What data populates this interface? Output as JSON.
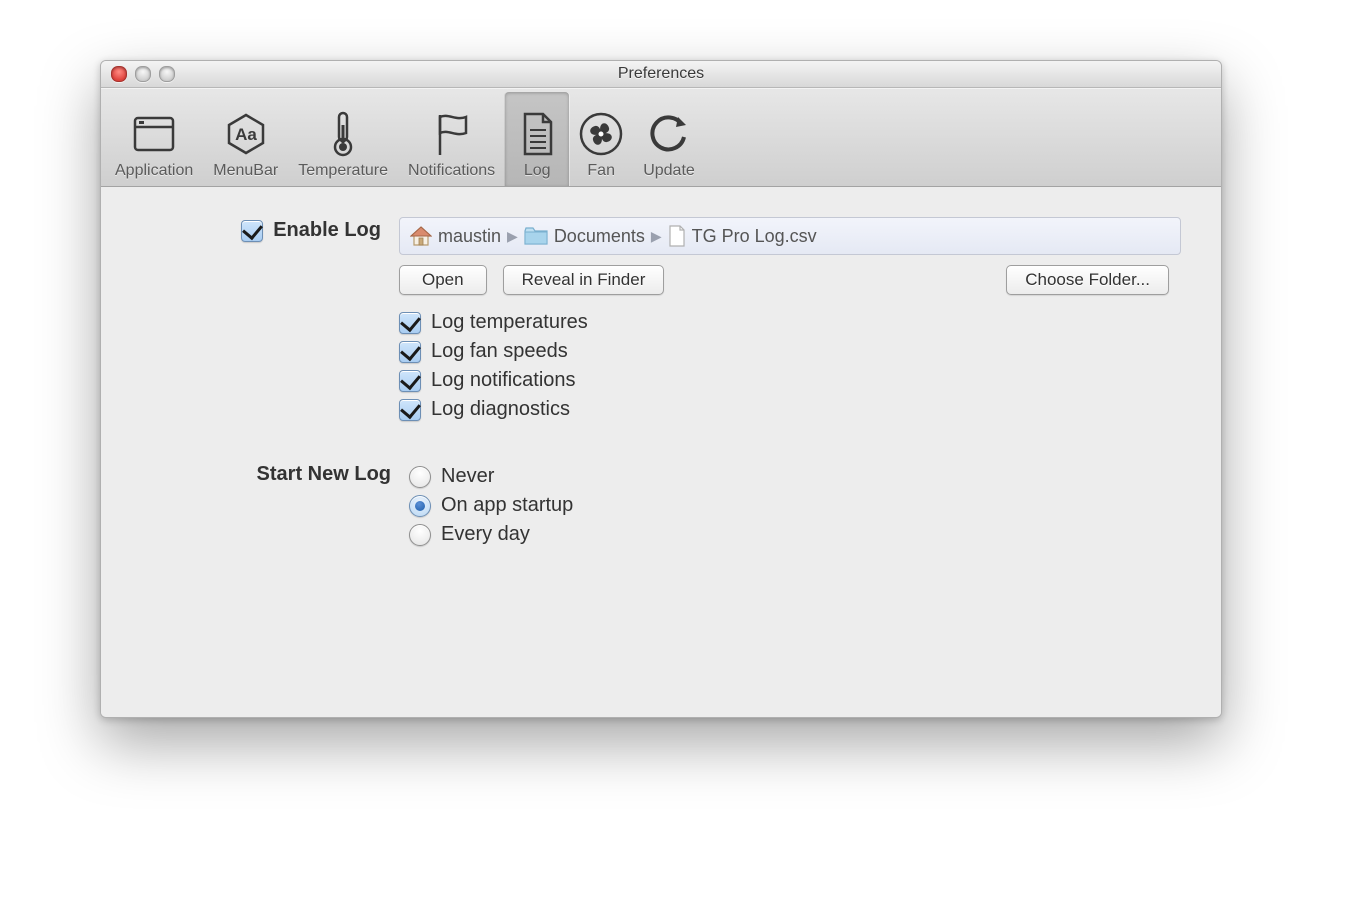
{
  "window": {
    "title": "Preferences"
  },
  "toolbar": {
    "items": [
      {
        "label": "Application",
        "icon": "window-icon",
        "selected": false
      },
      {
        "label": "MenuBar",
        "icon": "aa-hex-icon",
        "selected": false
      },
      {
        "label": "Temperature",
        "icon": "thermometer-icon",
        "selected": false
      },
      {
        "label": "Notifications",
        "icon": "flag-icon",
        "selected": false
      },
      {
        "label": "Log",
        "icon": "document-icon",
        "selected": true
      },
      {
        "label": "Fan",
        "icon": "fan-icon",
        "selected": false
      },
      {
        "label": "Update",
        "icon": "refresh-icon",
        "selected": false
      }
    ]
  },
  "log": {
    "enable_label": "Enable Log",
    "enable_checked": true,
    "path": [
      {
        "icon": "home-icon",
        "label": "maustin"
      },
      {
        "icon": "folder-icon",
        "label": "Documents"
      },
      {
        "icon": "file-icon",
        "label": "TG Pro Log.csv"
      }
    ],
    "buttons": {
      "open": "Open",
      "reveal": "Reveal in Finder",
      "choose": "Choose Folder..."
    },
    "options": [
      {
        "label": "Log temperatures",
        "checked": true
      },
      {
        "label": "Log fan speeds",
        "checked": true
      },
      {
        "label": "Log notifications",
        "checked": true
      },
      {
        "label": "Log diagnostics",
        "checked": true
      }
    ],
    "start_new_label": "Start New Log",
    "start_new": {
      "options": [
        {
          "label": "Never",
          "selected": false
        },
        {
          "label": "On app startup",
          "selected": true
        },
        {
          "label": "Every day",
          "selected": false
        }
      ]
    }
  }
}
